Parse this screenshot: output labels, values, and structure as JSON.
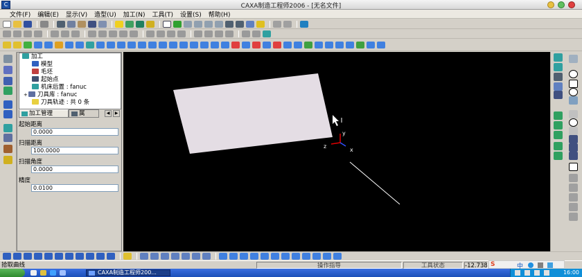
{
  "window": {
    "title": "CAXA制造工程师2006 - [无名文件]",
    "app_icon": "caxa-logo-icon"
  },
  "menu": [
    "文件(F)",
    "编辑(E)",
    "显示(V)",
    "造型(U)",
    "加工(N)",
    "工具(T)",
    "设置(S)",
    "帮助(H)"
  ],
  "tree": {
    "root": "加工",
    "children": [
      "模型",
      "毛坯",
      "起始点",
      "机床后置 : fanuc",
      "刀具库 : fanuc",
      "刀具轨迹 : 共 0 条"
    ]
  },
  "tabs": {
    "active": "加工管理",
    "second": "属"
  },
  "params": [
    {
      "label": "起始距离",
      "value": "0.0000"
    },
    {
      "label": "扫描距离",
      "value": "100.0000"
    },
    {
      "label": "扫描角度",
      "value": "0.0000"
    },
    {
      "label": "精度",
      "value": "0.0100"
    }
  ],
  "viewport": {
    "axis_x": "x",
    "axis_y": "y",
    "axis_z": "z"
  },
  "status": {
    "prompt": "拾取曲线",
    "op": "操作指导",
    "tool_state": "工具状态",
    "coord": "-12.738"
  },
  "taskbar": {
    "app": "CAXA制造工程师200...",
    "clock": "16:00",
    "ime": "中"
  },
  "colors": {
    "canvas_bg": "#000000",
    "plane_fill": "#e4dde4",
    "axis_red": "#e00000",
    "axis_blue": "#3050ff"
  }
}
